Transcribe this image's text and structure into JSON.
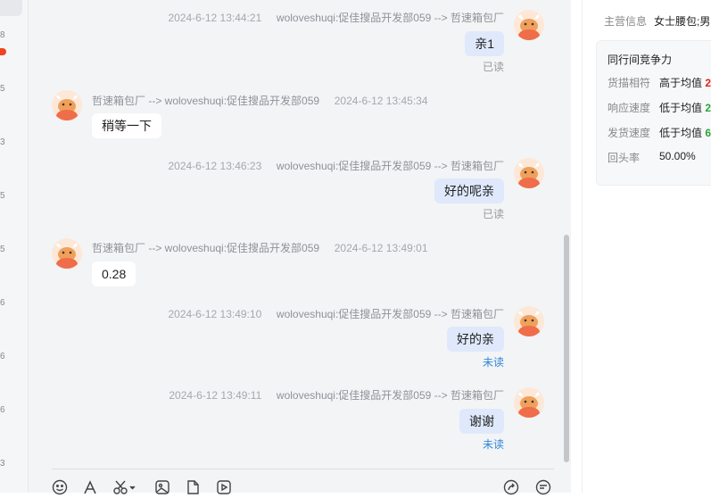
{
  "left_strip": {
    "numbers": [
      "8",
      "5",
      "3",
      "5",
      "5",
      "6",
      "6",
      "6",
      "3"
    ]
  },
  "messages": [
    {
      "dir": "out",
      "time": "2024-6-12 13:44:21",
      "route": "woloveshuqi:促佳搜品开发部059 --> 哲速箱包厂",
      "text": "亲1",
      "status": "已读"
    },
    {
      "dir": "in",
      "time": "2024-6-12 13:45:34",
      "route": "哲速箱包厂 --> woloveshuqi:促佳搜品开发部059",
      "text": "稍等一下"
    },
    {
      "dir": "out",
      "time": "2024-6-12 13:46:23",
      "route": "woloveshuqi:促佳搜品开发部059 --> 哲速箱包厂",
      "text": "好的呢亲",
      "status": "已读"
    },
    {
      "dir": "in",
      "time": "2024-6-12 13:49:01",
      "route": "哲速箱包厂 --> woloveshuqi:促佳搜品开发部059",
      "text": "0.28"
    },
    {
      "dir": "out",
      "time": "2024-6-12 13:49:10",
      "route": "woloveshuqi:促佳搜品开发部059 --> 哲速箱包厂",
      "text": "好的亲",
      "status": "未读"
    },
    {
      "dir": "out",
      "time": "2024-6-12 13:49:11",
      "route": "woloveshuqi:促佳搜品开发部059 --> 哲速箱包厂",
      "text": "谢谢",
      "status": "未读"
    }
  ],
  "toolbar": {
    "icons": [
      "emoji-icon",
      "font-icon",
      "scissors-icon",
      "image-icon",
      "file-icon",
      "video-icon",
      "share-icon",
      "quick-reply-icon"
    ]
  },
  "right_panel": {
    "main_business_label": "主营信息",
    "main_business_value": "女士腰包;男",
    "compete_title": "同行间竞争力",
    "rows": [
      {
        "label": "货描相符",
        "value": "高于均值",
        "extra": "2",
        "color": "#e3231c"
      },
      {
        "label": "响应速度",
        "value": "低于均值",
        "extra": "2",
        "color": "#2fa33a"
      },
      {
        "label": "发货速度",
        "value": "低于均值",
        "extra": "6",
        "color": "#2fa33a"
      },
      {
        "label": "回头率",
        "value": "50.00%",
        "extra": ""
      }
    ]
  }
}
